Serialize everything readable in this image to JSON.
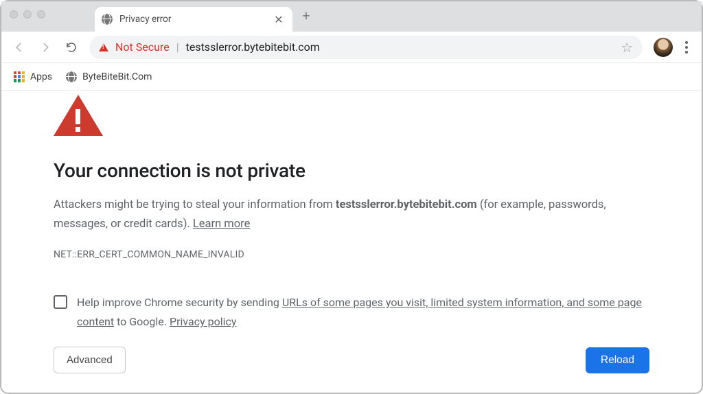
{
  "tab": {
    "title": "Privacy error"
  },
  "omnibox": {
    "security_label": "Not Secure",
    "url": "testsslerror.bytebitebit.com"
  },
  "bookmarks": {
    "apps_label": "Apps",
    "items": [
      "ByteBiteBit.Com"
    ]
  },
  "error": {
    "heading": "Your connection is not private",
    "desc_prefix": "Attackers might be trying to steal your information from ",
    "domain": "testsslerror.bytebitebit.com",
    "desc_suffix": " (for example, passwords, messages, or credit cards). ",
    "learn_more": "Learn more",
    "code": "NET::ERR_CERT_COMMON_NAME_INVALID",
    "optin_prefix": "Help improve Chrome security by sending ",
    "optin_link1": "URLs of some pages you visit, limited system information, and some page content",
    "optin_mid": " to Google. ",
    "optin_link2": "Privacy policy",
    "advanced": "Advanced",
    "reload": "Reload"
  }
}
